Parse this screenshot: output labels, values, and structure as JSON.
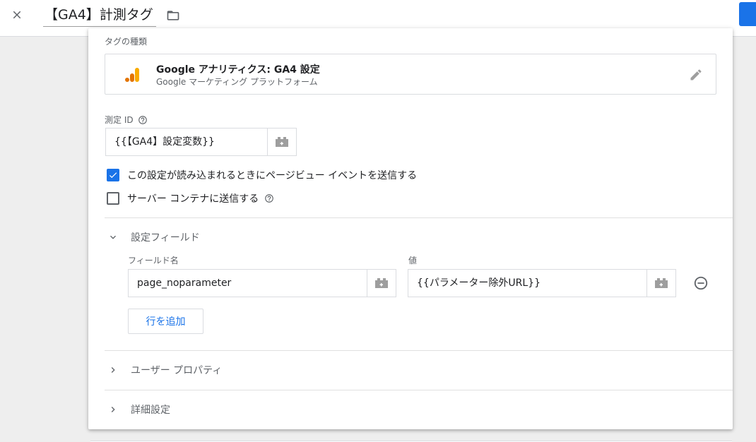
{
  "header": {
    "tag_name": "【GA4】計測タグ"
  },
  "tag_config": {
    "section_label": "タグの種類",
    "tag_type": {
      "name": "Google アナリティクス: GA4 設定",
      "vendor": "Google マーケティング プラットフォーム",
      "icon": "google-analytics-icon"
    },
    "measurement_id": {
      "label": "測定 ID",
      "value": "{{【GA4】設定変数}}"
    },
    "send_pageview": {
      "label": "この設定が読み込まれるときにページビュー イベントを送信する",
      "checked": true
    },
    "send_to_server": {
      "label": "サーバー コンテナに送信する",
      "checked": false
    },
    "fields_section": {
      "title": "設定フィールド",
      "expanded": true,
      "field_name_header": "フィールド名",
      "value_header": "値",
      "rows": [
        {
          "field_name": "page_noparameter",
          "value": "{{パラメーター除外URL}}"
        }
      ],
      "add_row_label": "行を追加"
    },
    "user_properties": {
      "title": "ユーザー プロパティ",
      "expanded": false
    },
    "advanced_settings": {
      "title": "詳細設定",
      "expanded": false
    }
  },
  "colors": {
    "accent": "#1a73e8",
    "ga_orange": "#f9ab00",
    "ga_dark_orange": "#e37400"
  }
}
